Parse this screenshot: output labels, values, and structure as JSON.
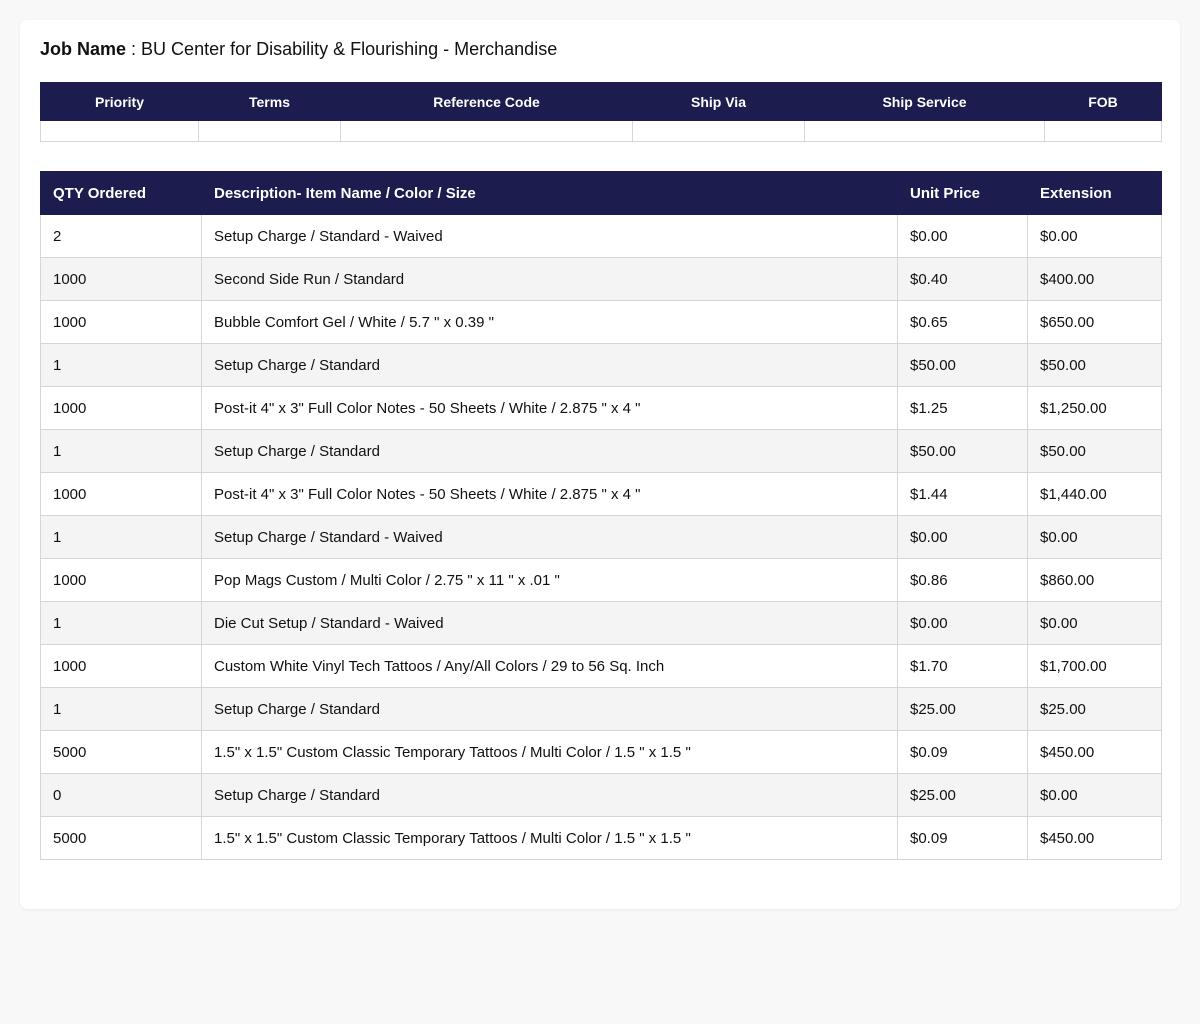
{
  "job": {
    "label": "Job Name",
    "separator": " : ",
    "value": "BU Center for Disability & Flourishing - Merchandise"
  },
  "shipping": {
    "headers": [
      "Priority",
      "Terms",
      "Reference Code",
      "Ship Via",
      "Ship Service",
      "FOB"
    ],
    "values": [
      "",
      "",
      "",
      "",
      "",
      ""
    ]
  },
  "items": {
    "headers": [
      "QTY Ordered",
      "Description- Item Name / Color / Size",
      "Unit Price",
      "Extension"
    ],
    "rows": [
      {
        "qty": "2",
        "description": "Setup Charge / Standard - Waived",
        "unit_price": "$0.00",
        "extension": "$0.00"
      },
      {
        "qty": "1000",
        "description": "Second Side Run / Standard",
        "unit_price": "$0.40",
        "extension": "$400.00"
      },
      {
        "qty": "1000",
        "description": "Bubble Comfort Gel / White / 5.7 \" x 0.39 \"",
        "unit_price": "$0.65",
        "extension": "$650.00"
      },
      {
        "qty": "1",
        "description": "Setup Charge / Standard",
        "unit_price": "$50.00",
        "extension": "$50.00"
      },
      {
        "qty": "1000",
        "description": "Post-it 4\" x 3\" Full Color Notes - 50 Sheets / White / 2.875 \" x 4 \"",
        "unit_price": "$1.25",
        "extension": "$1,250.00"
      },
      {
        "qty": "1",
        "description": "Setup Charge / Standard",
        "unit_price": "$50.00",
        "extension": "$50.00"
      },
      {
        "qty": "1000",
        "description": "Post-it 4\" x 3\" Full Color Notes - 50 Sheets / White / 2.875 \" x 4 \"",
        "unit_price": "$1.44",
        "extension": "$1,440.00"
      },
      {
        "qty": "1",
        "description": "Setup Charge / Standard - Waived",
        "unit_price": "$0.00",
        "extension": "$0.00"
      },
      {
        "qty": "1000",
        "description": "Pop Mags Custom / Multi Color / 2.75 \" x 11 \" x .01 \"",
        "unit_price": "$0.86",
        "extension": "$860.00"
      },
      {
        "qty": "1",
        "description": "Die Cut Setup / Standard - Waived",
        "unit_price": "$0.00",
        "extension": "$0.00"
      },
      {
        "qty": "1000",
        "description": "Custom White Vinyl Tech Tattoos / Any/All Colors / 29 to 56 Sq. Inch",
        "unit_price": "$1.70",
        "extension": "$1,700.00"
      },
      {
        "qty": "1",
        "description": "Setup Charge / Standard",
        "unit_price": "$25.00",
        "extension": "$25.00"
      },
      {
        "qty": "5000",
        "description": "1.5\" x 1.5\" Custom Classic Temporary Tattoos / Multi Color / 1.5 \" x 1.5 \"",
        "unit_price": "$0.09",
        "extension": "$450.00"
      },
      {
        "qty": "0",
        "description": "Setup Charge / Standard",
        "unit_price": "$25.00",
        "extension": "$0.00"
      },
      {
        "qty": "5000",
        "description": "1.5\" x 1.5\" Custom Classic Temporary Tattoos / Multi Color / 1.5 \" x 1.5 \"",
        "unit_price": "$0.09",
        "extension": "$450.00"
      }
    ]
  },
  "colors": {
    "header_bg": "#1c1c4e",
    "row_alt_bg": "#f4f4f4",
    "page_bg": "#f8f8f8"
  }
}
